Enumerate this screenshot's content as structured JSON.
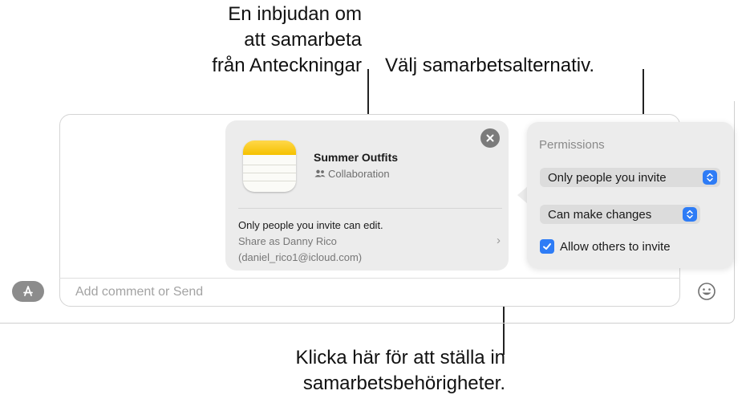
{
  "callouts": {
    "top_left": [
      "En inbjudan om",
      "att samarbeta",
      "från Anteckningar"
    ],
    "top_right": "Välj samarbetsalternativ.",
    "bottom": [
      "Klicka här för att ställa in",
      "samarbetsbehörigheter."
    ]
  },
  "collab_card": {
    "title": "Summer Outfits",
    "subtitle": "Collaboration",
    "status": "Only people you invite can edit.",
    "share_as_line1": "Share as Danny Rico",
    "share_as_line2": "(daniel_rico1@icloud.com)",
    "chevron": "›"
  },
  "permissions": {
    "title": "Permissions",
    "who_can_access": "Only people you invite",
    "access_level": "Can make changes",
    "allow_others_label": "Allow others to invite",
    "allow_others_checked": true
  },
  "compose": {
    "placeholder": "Add comment or Send"
  },
  "icons": {
    "apps": "app-store-icon",
    "emoji": "emoji-icon",
    "close": "close-icon",
    "notes": "notes-app-icon",
    "people": "people-icon"
  },
  "colors": {
    "accent": "#2e7cf6",
    "card_bg": "#ececec",
    "notes_yellow": "#f5c100"
  }
}
